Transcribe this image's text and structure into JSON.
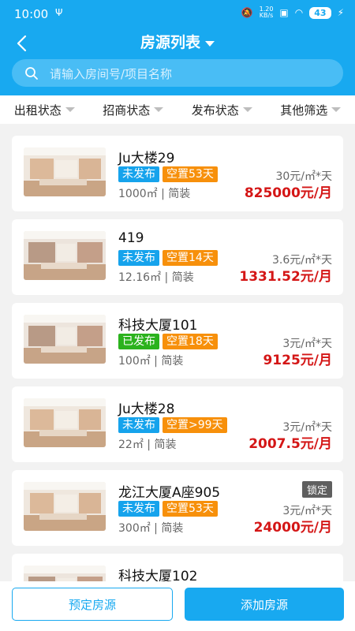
{
  "status_bar": {
    "time": "10:00",
    "usb": "Ψ",
    "data_rate": "1.20\nKB/s",
    "battery": "43"
  },
  "header": {
    "title": "房源列表",
    "back_icon": "chevron-left-icon"
  },
  "search": {
    "placeholder": "请输入房间号/项目名称"
  },
  "filters": [
    "出租状态",
    "招商状态",
    "发布状态",
    "其他筛选"
  ],
  "listings": [
    {
      "name": "Ju大楼29",
      "publish": "未发布",
      "publish_color": "blue",
      "vacancy": "空置53天",
      "area": "1000㎡",
      "decor": "简装",
      "unit_price": "30元/㎡*天",
      "monthly": "825000元/月",
      "locked": ""
    },
    {
      "name": "419",
      "publish": "未发布",
      "publish_color": "blue",
      "vacancy": "空置14天",
      "area": "12.16㎡",
      "decor": "简装",
      "unit_price": "3.6元/㎡*天",
      "monthly": "1331.52元/月",
      "locked": ""
    },
    {
      "name": "科技大厦101",
      "publish": "已发布",
      "publish_color": "green",
      "vacancy": "空置18天",
      "area": "100㎡",
      "decor": "简装",
      "unit_price": "3元/㎡*天",
      "monthly": "9125元/月",
      "locked": ""
    },
    {
      "name": "Ju大楼28",
      "publish": "未发布",
      "publish_color": "blue",
      "vacancy": "空置>99天",
      "area": "22㎡",
      "decor": "简装",
      "unit_price": "3元/㎡*天",
      "monthly": "2007.5元/月",
      "locked": ""
    },
    {
      "name": "龙江大厦A座905",
      "publish": "未发布",
      "publish_color": "blue",
      "vacancy": "空置53天",
      "area": "300㎡",
      "decor": "简装",
      "unit_price": "3元/㎡*天",
      "monthly": "24000元/月",
      "locked": "锁定"
    },
    {
      "name": "科技大厦102",
      "publish": "",
      "publish_color": "blue",
      "vacancy": "",
      "area": "",
      "decor": "",
      "unit_price": "",
      "monthly": "",
      "locked": ""
    }
  ],
  "bottom": {
    "reserve_label": "预定房源",
    "add_label": "添加房源"
  },
  "colors": {
    "primary": "#18a9f0",
    "price_red": "#d41616",
    "tag_blue": "#16a3ec",
    "tag_green": "#2bb21d",
    "tag_orange": "#f7900b"
  }
}
